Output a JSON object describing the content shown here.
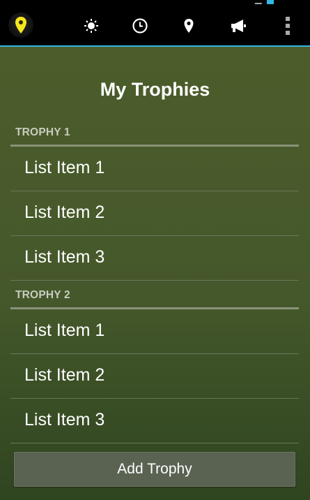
{
  "action_bar": {
    "icons": [
      "location-pin-app-icon",
      "brightness-icon",
      "clock-icon",
      "map-pin-icon",
      "megaphone-icon",
      "overflow-menu-icon"
    ]
  },
  "page": {
    "title": "My Trophies"
  },
  "sections": [
    {
      "header": "TROPHY 1",
      "items": [
        "List Item 1",
        "List Item 2",
        "List Item 3"
      ]
    },
    {
      "header": "TROPHY 2",
      "items": [
        "List Item 1",
        "List Item 2",
        "List Item 3"
      ]
    }
  ],
  "buttons": {
    "add_trophy": "Add Trophy"
  },
  "colors": {
    "accent": "#33b5e5",
    "background_top": "#4c5d2b",
    "background_bottom": "#2f4520",
    "app_icon_pin": "#f5e61e"
  }
}
